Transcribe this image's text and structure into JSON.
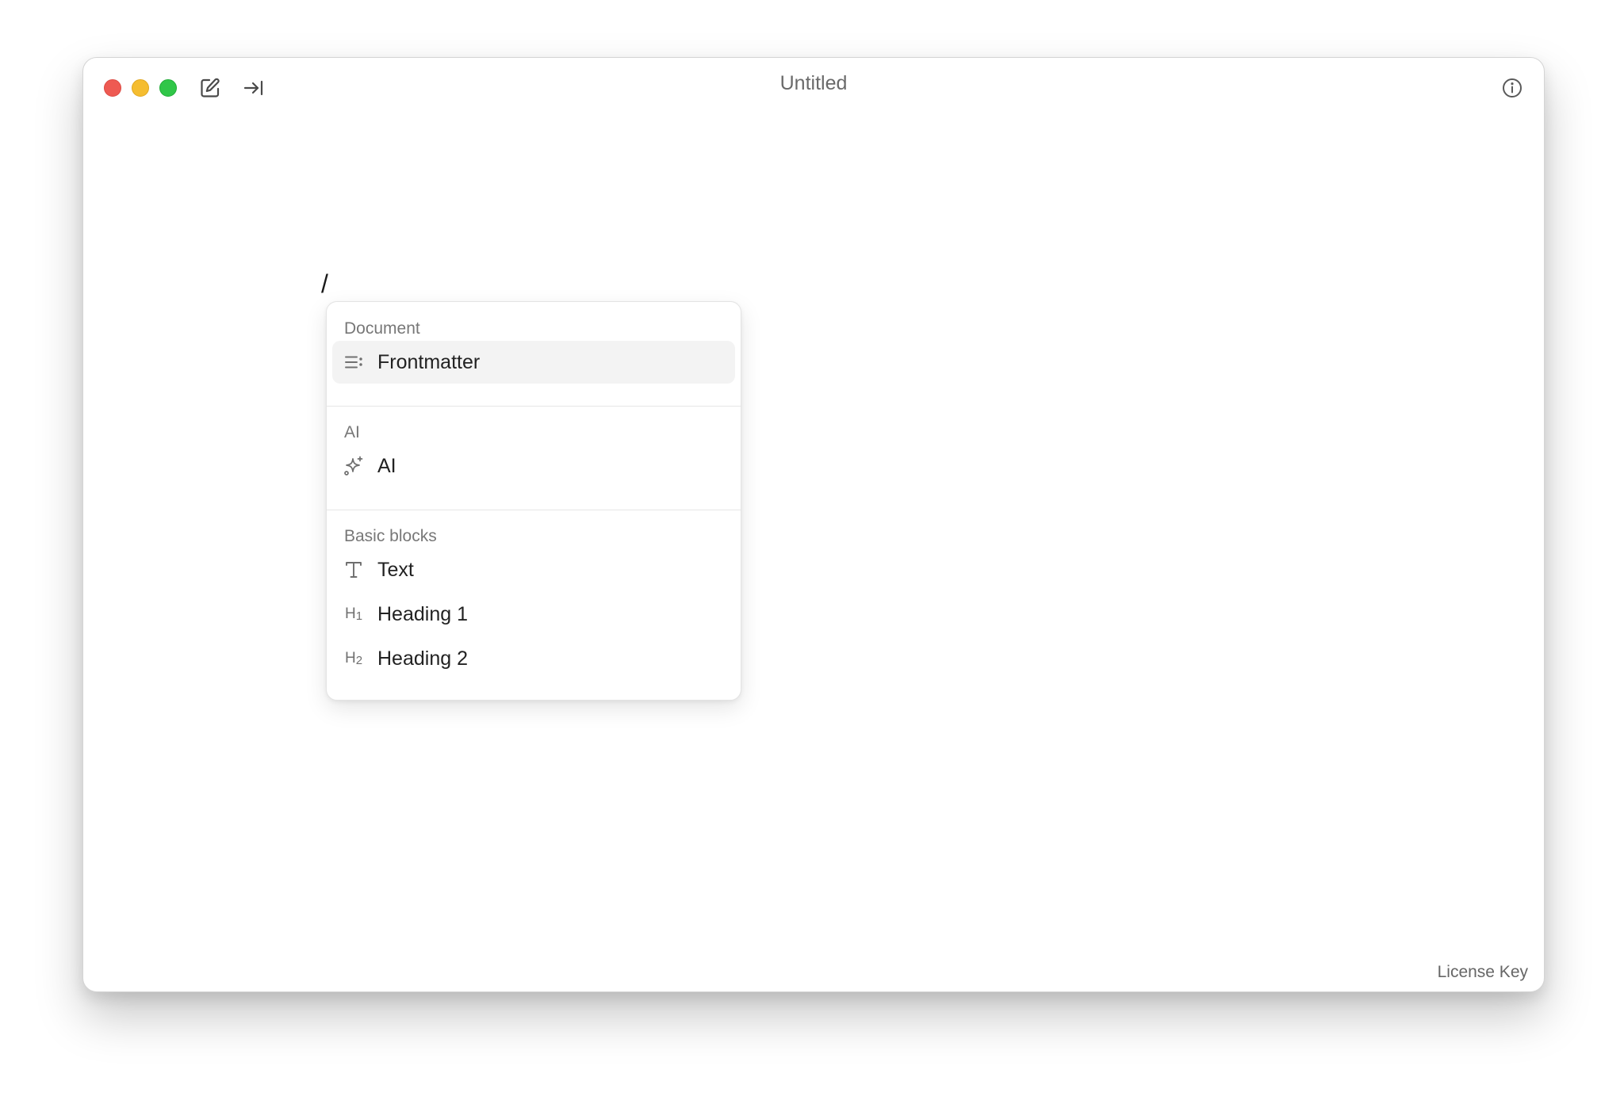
{
  "window": {
    "title": "Untitled"
  },
  "titlebar": {
    "icons": [
      "close-button",
      "minimize-button",
      "maximize-button",
      "compose-icon",
      "arrow-to-right-icon",
      "info-icon"
    ]
  },
  "editor": {
    "text": "/"
  },
  "slash_menu": {
    "sections": [
      {
        "label": "Document",
        "items": [
          {
            "label": "Frontmatter",
            "icon": "list-lines-icon",
            "selected": true
          }
        ]
      },
      {
        "label": "AI",
        "items": [
          {
            "label": "AI",
            "icon": "sparkles-icon",
            "selected": false
          }
        ]
      },
      {
        "label": "Basic blocks",
        "items": [
          {
            "label": "Text",
            "icon": "text-t-icon",
            "selected": false
          },
          {
            "label": "Heading 1",
            "icon": "heading-1-icon",
            "selected": false
          },
          {
            "label": "Heading 2",
            "icon": "heading-2-icon",
            "selected": false
          }
        ]
      }
    ],
    "heading_icon_text": {
      "h1": "H",
      "h1_sub": "1",
      "h2": "H",
      "h2_sub": "2"
    }
  },
  "footer": {
    "license_label": "License Key"
  },
  "colors": {
    "close": "#ee5a52",
    "minimize": "#f5bd30",
    "maximize": "#30c648",
    "selected_bg": "#f3f3f3"
  }
}
